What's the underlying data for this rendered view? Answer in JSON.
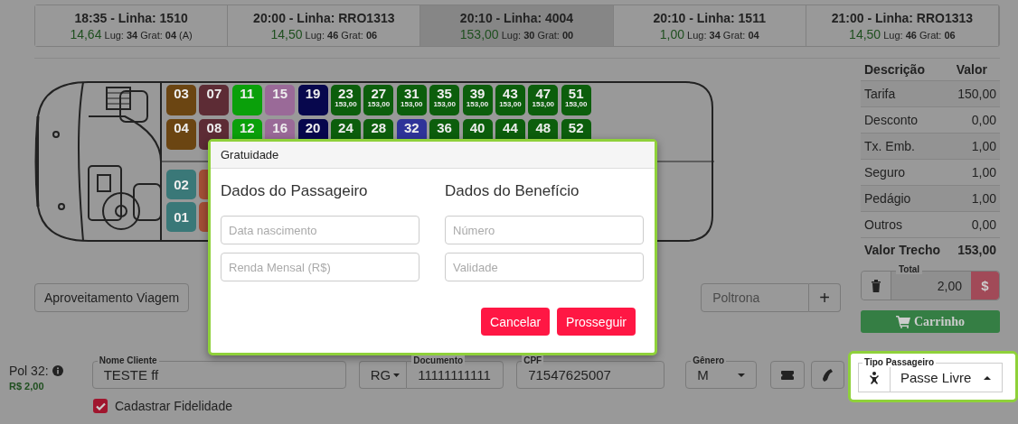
{
  "trips": [
    {
      "title": "18:35 - Linha: 1510",
      "price": "14,64",
      "details": "Lug: **34** Grat: **04** (A)",
      "selected": false
    },
    {
      "title": "20:00 - Linha: RRO1313",
      "price": "14,50",
      "details": "Lug: **46** Grat: **06**",
      "selected": false
    },
    {
      "title": "20:10 - Linha: 4004",
      "price": "153,00",
      "details": "Lug: **30** Grat: **00**",
      "selected": true
    },
    {
      "title": "20:10 - Linha: 1511",
      "price": "1,00",
      "details": "Lug: **34** Grat: **04**",
      "selected": false
    },
    {
      "title": "21:00 - Linha: RRO1313",
      "price": "14,50",
      "details": "Lug: **46** Grat: **06**",
      "selected": false
    }
  ],
  "bus": {
    "seat_rows": [
      [
        {
          "number": "03",
          "color": "#6b4512"
        },
        {
          "number": "07",
          "color": "#5d2c35"
        },
        {
          "number": "11",
          "color": "#0aa00a"
        },
        {
          "number": "15",
          "color": "#9a6a98"
        },
        {
          "number": "19",
          "color": "#07074d"
        },
        {
          "number": "23",
          "price": "153,00",
          "color": "#0c5e0c"
        },
        {
          "number": "27",
          "price": "153,00",
          "color": "#0c5e0c"
        },
        {
          "number": "31",
          "price": "153,00",
          "color": "#0c5e0c"
        },
        {
          "number": "35",
          "price": "153,00",
          "color": "#0c5e0c"
        },
        {
          "number": "39",
          "price": "153,00",
          "color": "#0c5e0c"
        },
        {
          "number": "43",
          "price": "153,00",
          "color": "#0c5e0c"
        },
        {
          "number": "47",
          "price": "153,00",
          "color": "#0c5e0c"
        },
        {
          "number": "51",
          "price": "153,00",
          "color": "#0c5e0c"
        }
      ],
      [
        {
          "number": "04",
          "color": "#6b4512"
        },
        {
          "number": "08",
          "color": "#5d2c35"
        },
        {
          "number": "12",
          "color": "#0aa00a"
        },
        {
          "number": "16",
          "color": "#9a6a98"
        },
        {
          "number": "20",
          "color": "#07074d"
        },
        {
          "number": "24",
          "color": "#0c5e0c"
        },
        {
          "number": "28",
          "color": "#0c5e0c"
        },
        {
          "number": "32",
          "color": "#2f3399"
        },
        {
          "number": "36",
          "color": "#0c5e0c"
        },
        {
          "number": "40",
          "color": "#0c5e0c"
        },
        {
          "number": "44",
          "color": "#0c5e0c"
        },
        {
          "number": "48",
          "color": "#0c5e0c"
        },
        {
          "number": "52",
          "color": "#0c5e0c"
        }
      ],
      [
        {
          "number": "02",
          "color": "#3a7878"
        },
        {
          "color": "#a34e36"
        }
      ],
      [
        {
          "number": "01",
          "color": "#3a7878"
        },
        {
          "color": "#a34e36"
        }
      ]
    ]
  },
  "actions": {
    "reuse_button": "Aproveitamento Viagem",
    "seat_field": {
      "placeholder": "Poltrona"
    },
    "add_button": "+"
  },
  "fare": {
    "columns": [
      "Descrição",
      "Valor"
    ],
    "rows": [
      {
        "label": "Tarifa",
        "value": "150,00"
      },
      {
        "label": "Desconto",
        "value": "0,00"
      },
      {
        "label": "Tx. Emb.",
        "value": "1,00"
      },
      {
        "label": "Seguro",
        "value": "1,00"
      },
      {
        "label": "Pedágio",
        "value": "1,00"
      },
      {
        "label": "Outros",
        "value": "0,00"
      }
    ],
    "total_row": {
      "label": "Valor Trecho",
      "value": "153,00"
    },
    "total": {
      "label": "Total",
      "value": "2,00"
    },
    "pay_button": "$",
    "cart_button": "Carrinho"
  },
  "passenger": {
    "seat_label": "Pol 32:",
    "amount": "R$ 2,00",
    "name": {
      "label": "Nome Cliente",
      "value": "TESTE ff"
    },
    "document_type": "RG",
    "document": {
      "label": "Documento",
      "value": "11111111111"
    },
    "cpf": {
      "label": "CPF",
      "value": "71547625007"
    },
    "gender": {
      "label": "Gênero",
      "value": "M"
    },
    "passenger_type": {
      "label": "Tipo Passageiro",
      "value": "Passe Livre"
    },
    "loyalty": {
      "label": "Cadastrar Fidelidade",
      "checked": true
    }
  },
  "modal": {
    "title": "Gratuidade",
    "sections": [
      {
        "heading": "Dados do Passageiro",
        "fields": [
          {
            "placeholder": "Data nascimento"
          },
          {
            "placeholder": "Renda Mensal (R$)"
          }
        ]
      },
      {
        "heading": "Dados do Benefício",
        "fields": [
          {
            "placeholder": "Número"
          },
          {
            "placeholder": "Validade"
          }
        ]
      }
    ],
    "buttons": [
      "Cancelar",
      "Prosseguir"
    ]
  }
}
